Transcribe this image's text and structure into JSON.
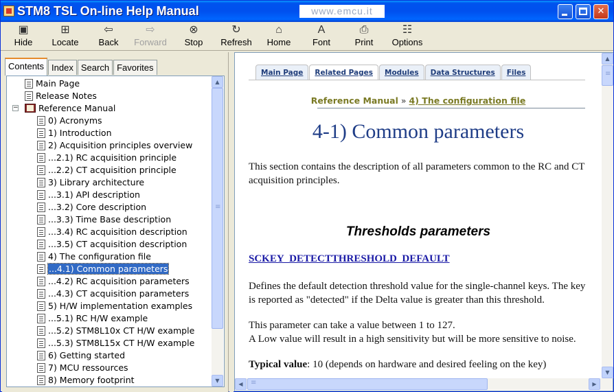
{
  "window": {
    "title": "STM8 TSL On-line Help Manual",
    "watermark": "www.emcu.it",
    "controls": {
      "minimize": "",
      "maximize": "",
      "close": "✕"
    }
  },
  "toolbar": {
    "buttons": [
      {
        "label": "Hide",
        "icon": "hide-icon",
        "glyph": "▣",
        "enabled": true
      },
      {
        "label": "Locate",
        "icon": "locate-icon",
        "glyph": "⊞",
        "enabled": true
      },
      {
        "label": "Back",
        "icon": "back-arrow-icon",
        "glyph": "⇦",
        "enabled": true
      },
      {
        "label": "Forward",
        "icon": "forward-arrow-icon",
        "glyph": "⇨",
        "enabled": false
      },
      {
        "label": "Stop",
        "icon": "stop-icon",
        "glyph": "⊗",
        "enabled": true
      },
      {
        "label": "Refresh",
        "icon": "refresh-icon",
        "glyph": "↻",
        "enabled": true
      },
      {
        "label": "Home",
        "icon": "home-icon",
        "glyph": "⌂",
        "enabled": true
      },
      {
        "label": "Font",
        "icon": "font-icon",
        "glyph": "A",
        "enabled": true
      },
      {
        "label": "Print",
        "icon": "print-icon",
        "glyph": "⎙",
        "enabled": true
      },
      {
        "label": "Options",
        "icon": "options-icon",
        "glyph": "☷",
        "enabled": true
      }
    ]
  },
  "nav_tabs": {
    "contents": "Contents",
    "index": "Index",
    "search": "Search",
    "favorites": "Favorites",
    "active": "Contents"
  },
  "tree": {
    "items": [
      {
        "label": "Main Page",
        "type": "doc",
        "level": 0
      },
      {
        "label": "Release Notes",
        "type": "doc",
        "level": 0
      },
      {
        "label": "Reference Manual",
        "type": "book",
        "level": 0,
        "expander": "−"
      },
      {
        "label": "0) Acronyms",
        "type": "doc",
        "level": 1
      },
      {
        "label": "1) Introduction",
        "type": "doc",
        "level": 1
      },
      {
        "label": "2) Acquisition principles overview",
        "type": "doc",
        "level": 1
      },
      {
        "label": "...2.1) RC acquisition principle",
        "type": "doc",
        "level": 1
      },
      {
        "label": "...2.2) CT acquisition principle",
        "type": "doc",
        "level": 1
      },
      {
        "label": "3) Library architecture",
        "type": "doc",
        "level": 1
      },
      {
        "label": "...3.1) API description",
        "type": "doc",
        "level": 1
      },
      {
        "label": "...3.2) Core description",
        "type": "doc",
        "level": 1
      },
      {
        "label": "...3.3) Time Base description",
        "type": "doc",
        "level": 1
      },
      {
        "label": "...3.4) RC acquisition description",
        "type": "doc",
        "level": 1
      },
      {
        "label": "...3.5) CT acquisition description",
        "type": "doc",
        "level": 1
      },
      {
        "label": "4) The configuration file",
        "type": "doc",
        "level": 1
      },
      {
        "label": "...4.1) Common parameters",
        "type": "doc",
        "level": 1,
        "selected": true
      },
      {
        "label": "...4.2) RC acquisition parameters",
        "type": "doc",
        "level": 1
      },
      {
        "label": "...4.3) CT acquisition parameters",
        "type": "doc",
        "level": 1
      },
      {
        "label": "5) H/W implementation examples",
        "type": "doc",
        "level": 1
      },
      {
        "label": "...5.1) RC H/W example",
        "type": "doc",
        "level": 1
      },
      {
        "label": "...5.2) STM8L10x CT H/W example",
        "type": "doc",
        "level": 1
      },
      {
        "label": "...5.3) STM8L15x CT H/W example",
        "type": "doc",
        "level": 1
      },
      {
        "label": "6) Getting started",
        "type": "doc",
        "level": 1
      },
      {
        "label": "7) MCU ressources",
        "type": "doc",
        "level": 1
      },
      {
        "label": "8) Memory footprint",
        "type": "doc",
        "level": 1
      }
    ]
  },
  "scrollbars": {
    "up": "▲",
    "down": "▼",
    "left": "◀",
    "right": "▶",
    "left_thumb_fraction": 0.84
  },
  "page": {
    "tabs": [
      {
        "label": "Main Page",
        "current": false
      },
      {
        "label": "Related Pages",
        "current": true
      },
      {
        "label": "Modules",
        "current": false
      },
      {
        "label": "Data Structures",
        "current": false
      },
      {
        "label": "Files",
        "current": false
      }
    ],
    "breadcrumb": {
      "parent": "Reference Manual",
      "separator": "»",
      "current": "4) The configuration file"
    },
    "title": "4-1) Common parameters",
    "intro": "This section contains the description of all parameters common to the RC and CT acquisition principles.",
    "section_title": "Thresholds parameters",
    "param_name": "SCKEY_DETECTTHRESHOLD_DEFAULT",
    "param_desc": "Defines the default detection threshold value for the single-channel keys. The key is reported as \"detected\" if the Delta value is greater than this threshold.",
    "range_line1": "This parameter can take a value between 1 to 127.",
    "range_line2": "A Low value will result in a high sensitivity but will be more sensitive to noise.",
    "typical_label": "Typical value",
    "typical_value": ": 10 (depends on hardware and desired feeling on the key)"
  }
}
